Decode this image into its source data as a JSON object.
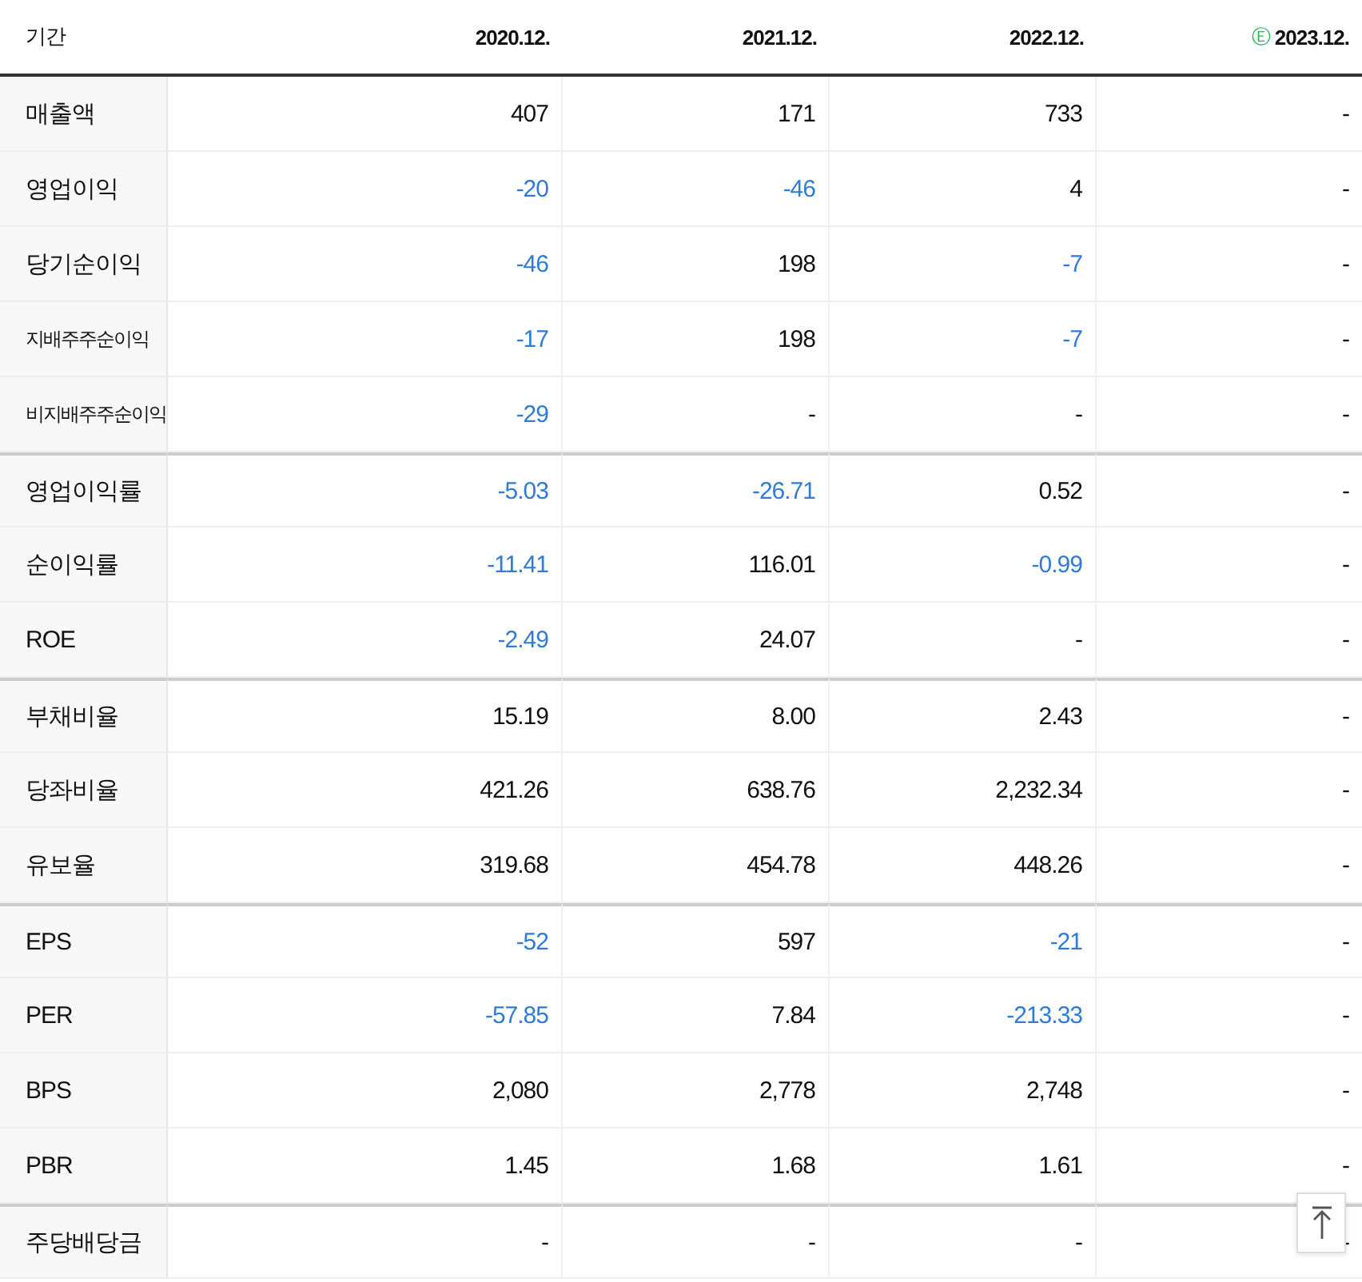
{
  "table": {
    "label_header": "기간",
    "columns": [
      {
        "text": "2020.12."
      },
      {
        "text": "2021.12."
      },
      {
        "text": "2022.12."
      },
      {
        "text": "2023.12.",
        "estimate_mark": "Ⓔ"
      }
    ],
    "rows": [
      {
        "label": "매출액",
        "compact": false,
        "group_start": false,
        "cells": [
          {
            "text": "407",
            "negative": false
          },
          {
            "text": "171",
            "negative": false
          },
          {
            "text": "733",
            "negative": false
          },
          {
            "text": "-",
            "negative": false
          }
        ]
      },
      {
        "label": "영업이익",
        "compact": false,
        "group_start": false,
        "cells": [
          {
            "text": "-20",
            "negative": true
          },
          {
            "text": "-46",
            "negative": true
          },
          {
            "text": "4",
            "negative": false
          },
          {
            "text": "-",
            "negative": false
          }
        ]
      },
      {
        "label": "당기순이익",
        "compact": false,
        "group_start": false,
        "cells": [
          {
            "text": "-46",
            "negative": true
          },
          {
            "text": "198",
            "negative": false
          },
          {
            "text": "-7",
            "negative": true
          },
          {
            "text": "-",
            "negative": false
          }
        ]
      },
      {
        "label": "지배주주순이익",
        "compact": true,
        "group_start": false,
        "cells": [
          {
            "text": "-17",
            "negative": true
          },
          {
            "text": "198",
            "negative": false
          },
          {
            "text": "-7",
            "negative": true
          },
          {
            "text": "-",
            "negative": false
          }
        ]
      },
      {
        "label": "비지배주주순이익",
        "compact": true,
        "group_start": false,
        "cells": [
          {
            "text": "-29",
            "negative": true
          },
          {
            "text": "-",
            "negative": false
          },
          {
            "text": "-",
            "negative": false
          },
          {
            "text": "-",
            "negative": false
          }
        ]
      },
      {
        "label": "영업이익률",
        "compact": false,
        "group_start": true,
        "cells": [
          {
            "text": "-5.03",
            "negative": true
          },
          {
            "text": "-26.71",
            "negative": true
          },
          {
            "text": "0.52",
            "negative": false
          },
          {
            "text": "-",
            "negative": false
          }
        ]
      },
      {
        "label": "순이익률",
        "compact": false,
        "group_start": false,
        "cells": [
          {
            "text": "-11.41",
            "negative": true
          },
          {
            "text": "116.01",
            "negative": false
          },
          {
            "text": "-0.99",
            "negative": true
          },
          {
            "text": "-",
            "negative": false
          }
        ]
      },
      {
        "label": "ROE",
        "compact": false,
        "group_start": false,
        "cells": [
          {
            "text": "-2.49",
            "negative": true
          },
          {
            "text": "24.07",
            "negative": false
          },
          {
            "text": "-",
            "negative": false
          },
          {
            "text": "-",
            "negative": false
          }
        ]
      },
      {
        "label": "부채비율",
        "compact": false,
        "group_start": true,
        "cells": [
          {
            "text": "15.19",
            "negative": false
          },
          {
            "text": "8.00",
            "negative": false
          },
          {
            "text": "2.43",
            "negative": false
          },
          {
            "text": "-",
            "negative": false
          }
        ]
      },
      {
        "label": "당좌비율",
        "compact": false,
        "group_start": false,
        "cells": [
          {
            "text": "421.26",
            "negative": false
          },
          {
            "text": "638.76",
            "negative": false
          },
          {
            "text": "2,232.34",
            "negative": false
          },
          {
            "text": "-",
            "negative": false
          }
        ]
      },
      {
        "label": "유보율",
        "compact": false,
        "group_start": false,
        "cells": [
          {
            "text": "319.68",
            "negative": false
          },
          {
            "text": "454.78",
            "negative": false
          },
          {
            "text": "448.26",
            "negative": false
          },
          {
            "text": "-",
            "negative": false
          }
        ]
      },
      {
        "label": "EPS",
        "compact": false,
        "group_start": true,
        "cells": [
          {
            "text": "-52",
            "negative": true
          },
          {
            "text": "597",
            "negative": false
          },
          {
            "text": "-21",
            "negative": true
          },
          {
            "text": "-",
            "negative": false
          }
        ]
      },
      {
        "label": "PER",
        "compact": false,
        "group_start": false,
        "cells": [
          {
            "text": "-57.85",
            "negative": true
          },
          {
            "text": "7.84",
            "negative": false
          },
          {
            "text": "-213.33",
            "negative": true
          },
          {
            "text": "-",
            "negative": false
          }
        ]
      },
      {
        "label": "BPS",
        "compact": false,
        "group_start": false,
        "cells": [
          {
            "text": "2,080",
            "negative": false
          },
          {
            "text": "2,778",
            "negative": false
          },
          {
            "text": "2,748",
            "negative": false
          },
          {
            "text": "-",
            "negative": false
          }
        ]
      },
      {
        "label": "PBR",
        "compact": false,
        "group_start": false,
        "cells": [
          {
            "text": "1.45",
            "negative": false
          },
          {
            "text": "1.68",
            "negative": false
          },
          {
            "text": "1.61",
            "negative": false
          },
          {
            "text": "-",
            "negative": false
          }
        ]
      },
      {
        "label": "주당배당금",
        "compact": false,
        "group_start": true,
        "cells": [
          {
            "text": "-",
            "negative": false
          },
          {
            "text": "-",
            "negative": false
          },
          {
            "text": "-",
            "negative": false
          },
          {
            "text": "-",
            "negative": false
          }
        ]
      }
    ]
  }
}
